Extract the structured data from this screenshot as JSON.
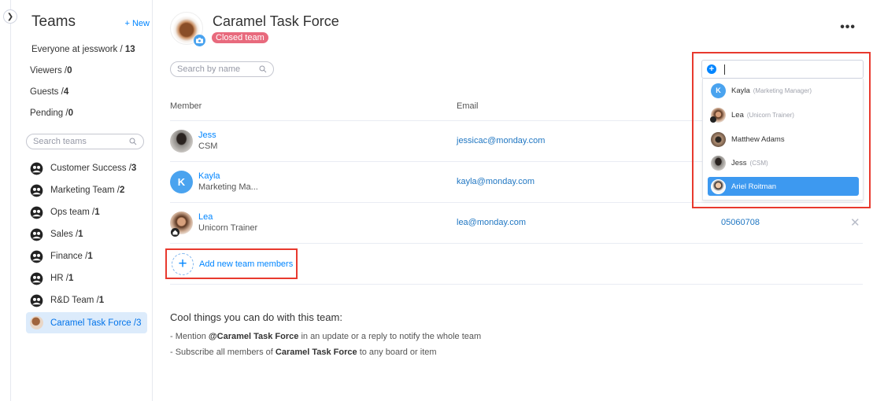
{
  "sidebar": {
    "collapse_icon": "chevron-right-icon",
    "title": "Teams",
    "new_label": "+ New",
    "stats": [
      {
        "label": "Everyone at jesswork / ",
        "count": "13"
      },
      {
        "label": "Viewers /",
        "count": "0"
      },
      {
        "label": "Guests /",
        "count": "4"
      },
      {
        "label": "Pending /",
        "count": "0"
      }
    ],
    "search_placeholder": "Search teams",
    "teams": [
      {
        "label": "Customer Success / ",
        "count": "3"
      },
      {
        "label": "Marketing Team / ",
        "count": "2"
      },
      {
        "label": "Ops team / ",
        "count": "1"
      },
      {
        "label": "Sales / ",
        "count": "1"
      },
      {
        "label": "Finance / ",
        "count": "1"
      },
      {
        "label": "HR / ",
        "count": "1"
      },
      {
        "label": "R&D Team / ",
        "count": "1"
      },
      {
        "label": "Caramel Task Force / ",
        "count": "3",
        "active": true
      }
    ]
  },
  "team": {
    "title": "Caramel Task Force",
    "badge": "Closed team",
    "more_icon": "•••",
    "search_placeholder": "Search by name"
  },
  "table": {
    "columns": [
      "Member",
      "Email"
    ],
    "members": [
      {
        "name": "Jess",
        "title": "CSM",
        "email": "jessicac@monday.com",
        "phone": ""
      },
      {
        "name": "Kayla",
        "title": "Marketing Ma...",
        "initial": "K",
        "email": "kayla@monday.com",
        "phone": ""
      },
      {
        "name": "Lea",
        "title": "Unicorn Trainer",
        "email": "lea@monday.com",
        "phone": "05060708"
      }
    ],
    "add_label": "Add new team members",
    "remove_icon": "✕"
  },
  "cool": {
    "title": "Cool things you can do with this team:",
    "line1_pre": "- Mention ",
    "line1_bold": "@Caramel Task Force",
    "line1_post": " in an update or a reply to notify the whole team",
    "line2_pre": "- Subscribe all members of ",
    "line2_bold": "Caramel Task Force",
    "line2_post": " to any board or item"
  },
  "dropdown": {
    "input_value": "",
    "options": [
      {
        "name": "Kayla",
        "role": "(Marketing Manager)",
        "initial": "K"
      },
      {
        "name": "Lea",
        "role": "(Unicorn Trainer)"
      },
      {
        "name": "Matthew Adams",
        "role": ""
      },
      {
        "name": "Jess",
        "role": "(CSM)"
      },
      {
        "name": "Ariel Roitman",
        "role": "",
        "selected": true
      }
    ]
  },
  "colors": {
    "accent": "#0085ff",
    "highlight": "#e8392e",
    "closed_badge": "#e86a7d",
    "selected_option": "#3d99f0"
  }
}
